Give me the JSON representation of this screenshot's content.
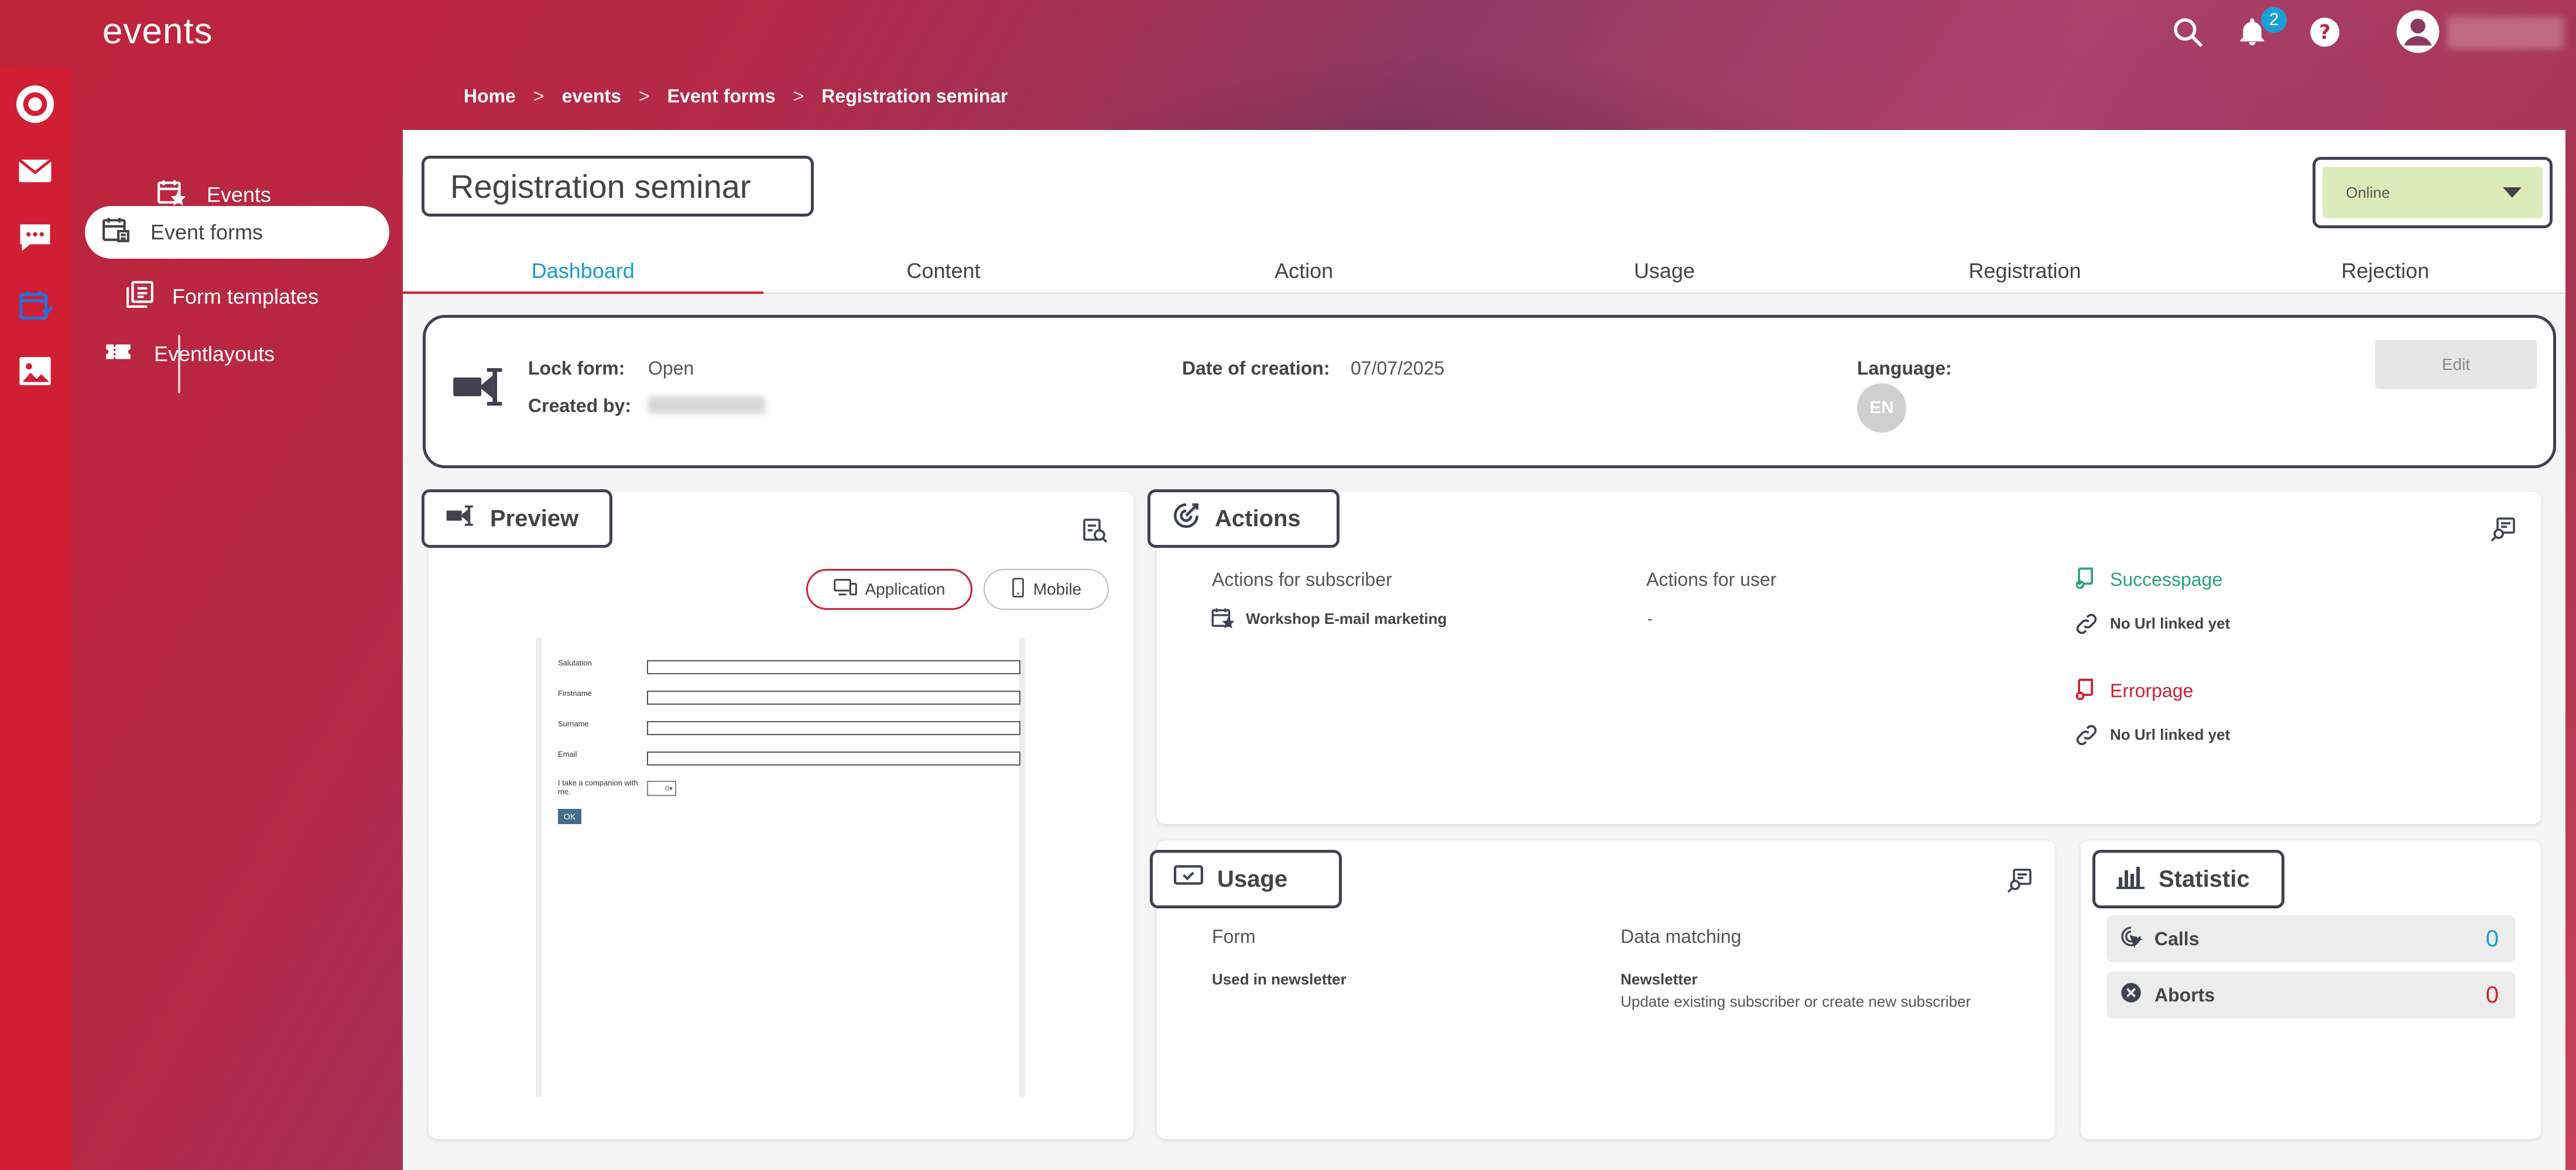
{
  "app": {
    "title": "events"
  },
  "topbar": {
    "notification_count": "2",
    "icons": [
      "search-icon",
      "bell-icon",
      "help-icon",
      "user-icon"
    ]
  },
  "rail": {
    "icons": [
      "logo-icon",
      "mail-icon",
      "sms-icon",
      "events-icon",
      "image-icon"
    ]
  },
  "nav": {
    "items": [
      {
        "label": "Events",
        "icon": "calendar-star-icon"
      },
      {
        "label": "Event forms",
        "icon": "calendar-form-icon"
      },
      {
        "label": "Form templates",
        "icon": "form-template-icon"
      },
      {
        "label": "Eventlayouts",
        "icon": "ticket-icon"
      }
    ]
  },
  "breadcrumb": [
    "Home",
    "events",
    "Event forms",
    "Registration seminar"
  ],
  "page": {
    "title": "Registration seminar",
    "status": "Online"
  },
  "tabs": [
    "Dashboard",
    "Content",
    "Action",
    "Usage",
    "Registration",
    "Rejection"
  ],
  "info": {
    "lock_form_label": "Lock form:",
    "lock_form_value": "Open",
    "created_by_label": "Created by:",
    "date_label": "Date of creation:",
    "date_value": "07/07/2025",
    "language_label": "Language:",
    "language_value": "EN",
    "edit_label": "Edit"
  },
  "preview": {
    "title": "Preview",
    "application_label": "Application",
    "mobile_label": "Mobile",
    "form_fields": [
      "Salutation",
      "Firstname",
      "Surname",
      "Email"
    ],
    "companion_label": "I take a companion with me.",
    "companion_value": "0",
    "ok_label": "OK"
  },
  "actions": {
    "title": "Actions",
    "subscriber_header": "Actions for subscriber",
    "user_header": "Actions for user",
    "subscriber_item": "Workshop E-mail marketing",
    "user_item": "-",
    "successpage_label": "Successpage",
    "successpage_url": "No Url linked yet",
    "errorpage_label": "Errorpage",
    "errorpage_url": "No Url linked yet"
  },
  "usage": {
    "title": "Usage",
    "form_header": "Form",
    "matching_header": "Data matching",
    "form_value": "Used in newsletter",
    "matching_title": "Newsletter",
    "matching_desc": "Update existing subscriber or create new subscriber"
  },
  "statistic": {
    "title": "Statistic",
    "calls_label": "Calls",
    "calls_value": "0",
    "aborts_label": "Aborts",
    "aborts_value": "0"
  },
  "colors": {
    "accent": "#d01f33",
    "tab_active": "#1a9bd0",
    "status_bg": "#d9edbb",
    "success": "#2aa37a"
  }
}
